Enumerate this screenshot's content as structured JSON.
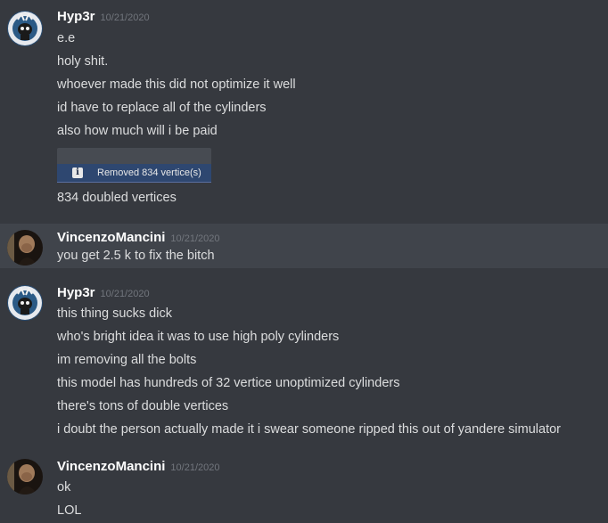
{
  "messages": [
    {
      "user": "Hyp3r",
      "time": "10/21/2020",
      "avatar_icon": "skull-avatar",
      "lines": [
        "e.e",
        "holy shit.",
        "whoever made this did not optimize it well",
        "id have to replace all of the cylinders",
        "also how much will i be paid"
      ],
      "attachment": {
        "icon": "info-icon",
        "text": "Removed 834 vertice(s)"
      },
      "after": "834 doubled vertices"
    },
    {
      "user": "VincenzoMancini",
      "time": "10/21/2020",
      "avatar_icon": "portrait-avatar",
      "lines": [
        "you get 2.5 k to fix the bitch"
      ]
    },
    {
      "user": "Hyp3r",
      "time": "10/21/2020",
      "avatar_icon": "skull-avatar",
      "lines": [
        "this thing sucks dick",
        "who's bright idea it was to use high poly cylinders",
        "im removing all the bolts",
        "this model has hundreds of 32 vertice unoptimized cylinders",
        "there's tons of double vertices",
        "i doubt the person actually made it i swear someone ripped this out of yandere simulator"
      ]
    },
    {
      "user": "VincenzoMancini",
      "time": "10/21/2020",
      "avatar_icon": "portrait-avatar",
      "lines": [
        "ok",
        "LOL"
      ]
    }
  ],
  "colors": {
    "background": "#36393f",
    "highlight": "#40444b",
    "username": "#ffffff",
    "text": "#dcddde",
    "timestamp": "#72767d"
  }
}
